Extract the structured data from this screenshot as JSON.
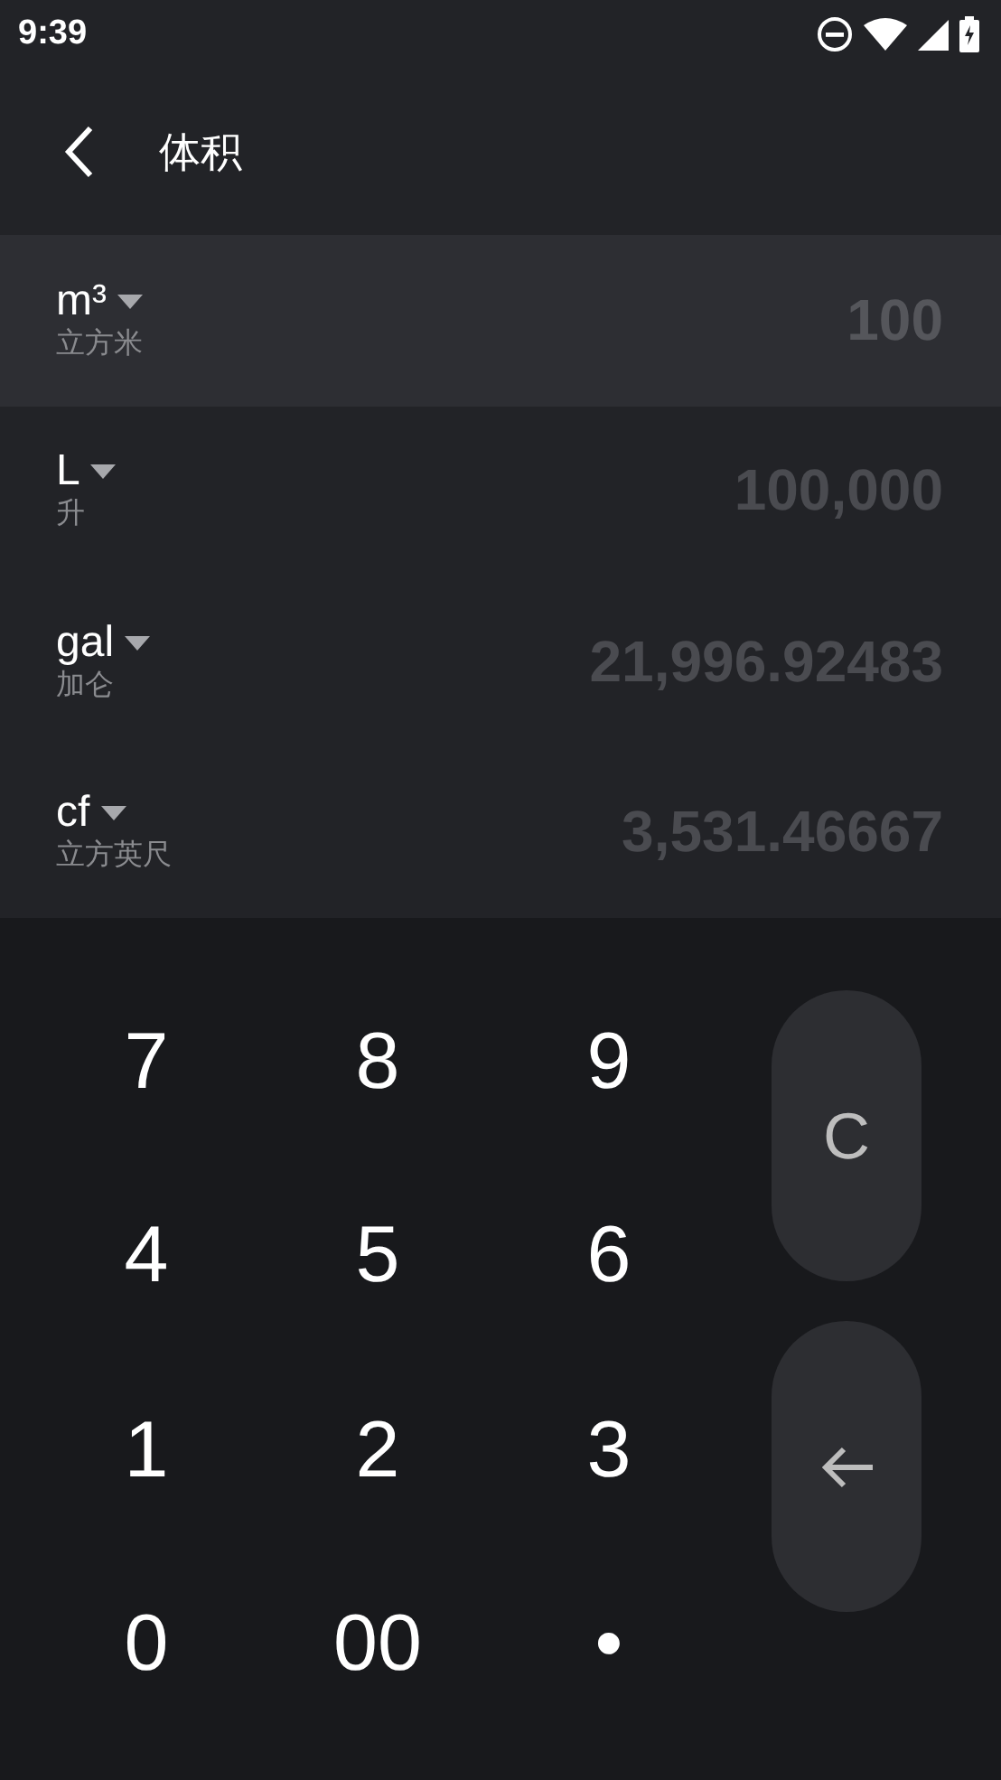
{
  "status_bar": {
    "time": "9:39"
  },
  "header": {
    "title": "体积"
  },
  "units": [
    {
      "symbol": "m³",
      "name": "立方米",
      "value": "100",
      "selected": true
    },
    {
      "symbol": "L",
      "name": "升",
      "value": "100,000",
      "selected": false
    },
    {
      "symbol": "gal",
      "name": "加仑",
      "value": "21,996.92483",
      "selected": false
    },
    {
      "symbol": "cf",
      "name": "立方英尺",
      "value": "3,531.46667",
      "selected": false
    }
  ],
  "keypad": {
    "keys": [
      "7",
      "8",
      "9",
      "4",
      "5",
      "6",
      "1",
      "2",
      "3",
      "0",
      "00",
      "•"
    ],
    "clear": "C"
  }
}
